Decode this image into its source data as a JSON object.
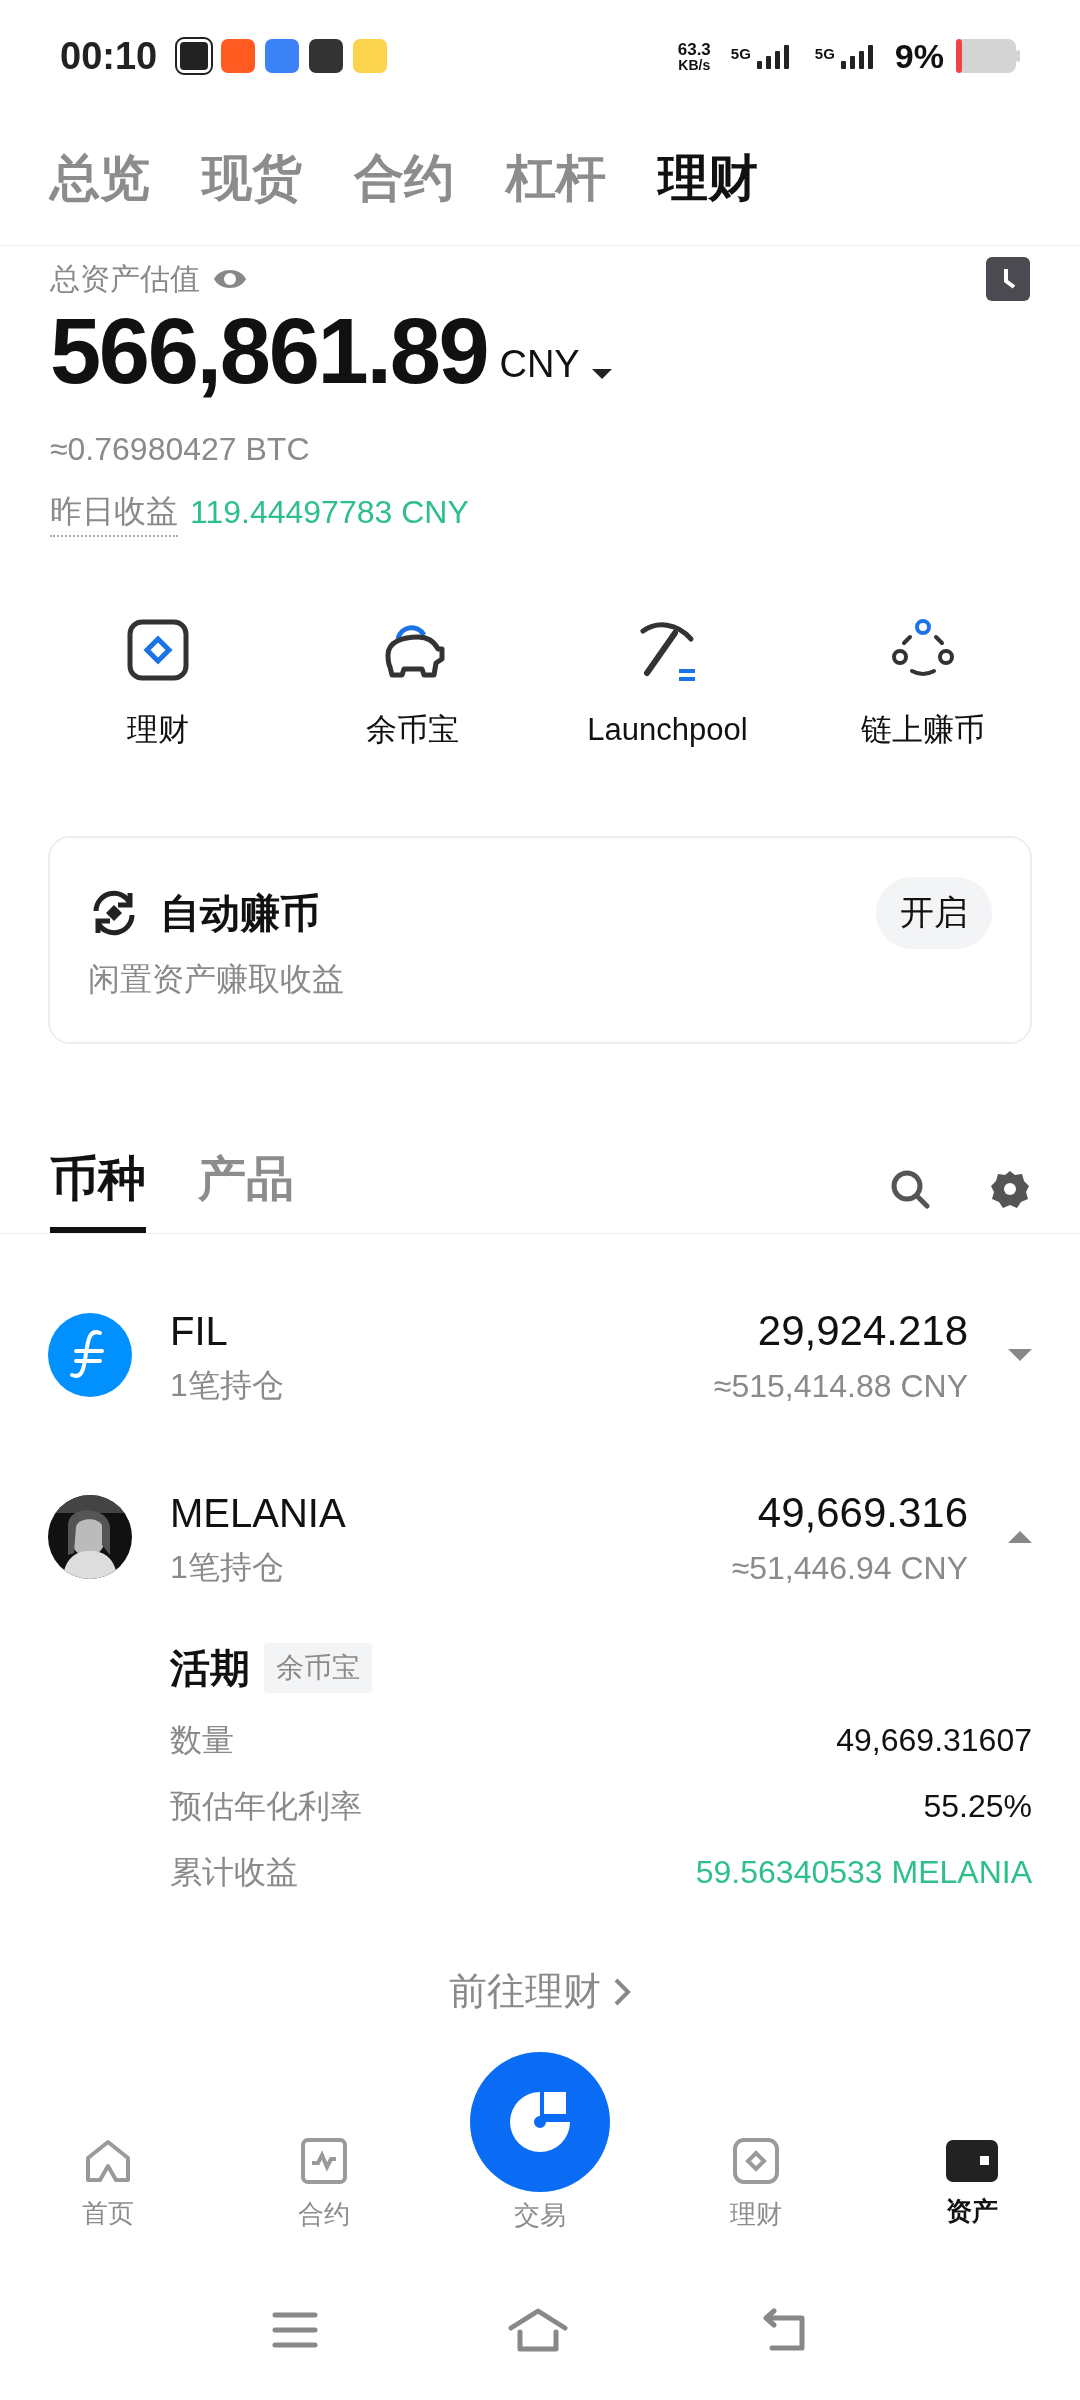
{
  "status_bar": {
    "time": "00:10",
    "net_speed": "63.3",
    "net_unit": "KB/s",
    "sims": [
      {
        "label": "5G"
      },
      {
        "label": "5G"
      }
    ],
    "battery": "9%"
  },
  "tabs": [
    {
      "label": "总览",
      "selected": false
    },
    {
      "label": "现货",
      "selected": false
    },
    {
      "label": "合约",
      "selected": false
    },
    {
      "label": "杠杆",
      "selected": false
    },
    {
      "label": "理财",
      "selected": true
    }
  ],
  "asset": {
    "label": "总资产估值",
    "amount": "566,861.89",
    "currency": "CNY",
    "btc": "≈0.76980427 BTC",
    "yesterday_label": "昨日收益",
    "yesterday_value": "119.44497783 CNY"
  },
  "shortcuts": [
    {
      "label": "理财",
      "kind": "finance"
    },
    {
      "label": "余币宝",
      "kind": "savings"
    },
    {
      "label": "Launchpool",
      "kind": "mining"
    },
    {
      "label": "链上赚币",
      "kind": "onchain"
    }
  ],
  "auto_earn": {
    "title": "自动赚币",
    "subtitle": "闲置资产赚取收益",
    "button": "开启"
  },
  "list_tabs": [
    {
      "label": "币种",
      "selected": true
    },
    {
      "label": "产品",
      "selected": false
    }
  ],
  "coins": [
    {
      "symbol": "FIL",
      "positions": "1笔持仓",
      "amount": "29,924.218",
      "value": "≈515,414.88 CNY",
      "expanded": false,
      "kind": "logo"
    },
    {
      "symbol": "MELANIA",
      "positions": "1笔持仓",
      "amount": "49,669.316",
      "value": "≈51,446.94 CNY",
      "expanded": true,
      "kind": "picture",
      "detail": {
        "title": "活期",
        "tag": "余币宝",
        "rows": [
          {
            "label": "数量",
            "value": "49,669.31607",
            "highlight": false
          },
          {
            "label": "预估年化利率",
            "value": "55.25%",
            "highlight": false
          },
          {
            "label": "累计收益",
            "value": "59.56340533 MELANIA",
            "highlight": true
          }
        ]
      }
    }
  ],
  "link": "前往理财",
  "nav": [
    {
      "label": "首页",
      "kind": "home",
      "selected": false
    },
    {
      "label": "合约",
      "kind": "chart",
      "selected": false
    },
    {
      "label": "交易",
      "kind": "trade",
      "selected": false
    },
    {
      "label": "理财",
      "kind": "finance",
      "selected": false
    },
    {
      "label": "资产",
      "kind": "wallet",
      "selected": true
    }
  ]
}
